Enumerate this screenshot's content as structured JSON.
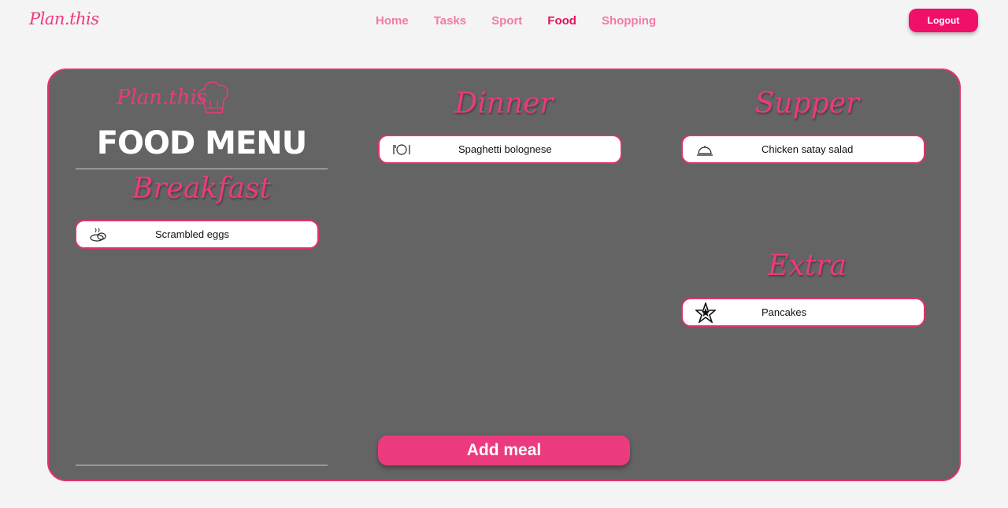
{
  "header": {
    "logo": "Plan.this",
    "nav": [
      "Home",
      "Tasks",
      "Sport",
      "Food",
      "Shopping"
    ],
    "active_nav": "Food",
    "logout_label": "Logout"
  },
  "menu": {
    "brand": "Plan.this",
    "title": "FOOD MENU",
    "add_meal_label": "Add meal",
    "sections": {
      "breakfast": {
        "title": "Breakfast",
        "items": [
          {
            "name": "Scrambled eggs",
            "icon": "eggs-icon"
          }
        ]
      },
      "dinner": {
        "title": "Dinner",
        "items": [
          {
            "name": "Spaghetti bolognese",
            "icon": "fork-plate-knife-icon"
          }
        ]
      },
      "supper": {
        "title": "Supper",
        "items": [
          {
            "name": "Chicken satay salad",
            "icon": "cloche-serving-icon"
          }
        ]
      },
      "extra": {
        "title": "Extra",
        "items": [
          {
            "name": "Pancakes",
            "icon": "star-icon"
          }
        ]
      }
    }
  },
  "colors": {
    "accent": "#ec3a7e",
    "active": "#e0145f",
    "panel": "#646464",
    "background": "#f4f4f4"
  }
}
